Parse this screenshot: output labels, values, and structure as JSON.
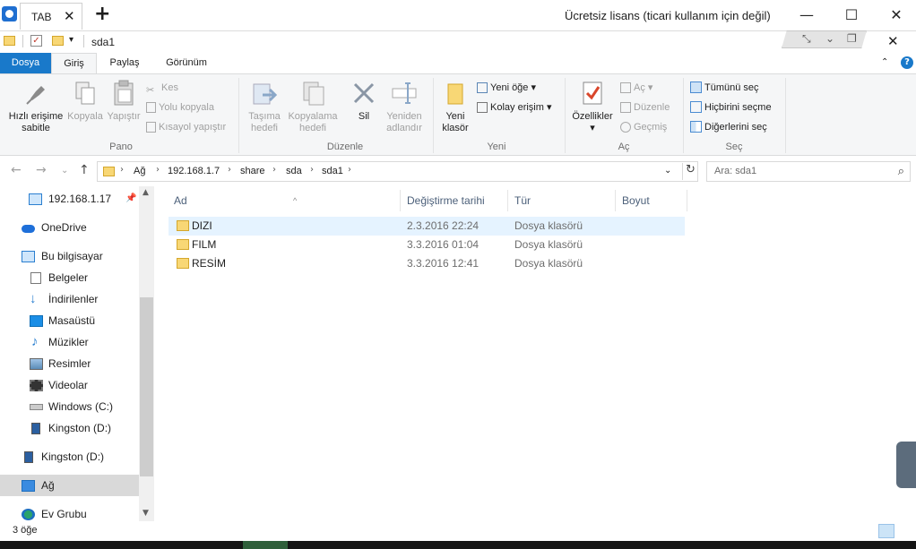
{
  "window": {
    "tab_label": "TAB",
    "license_text": "Ücretsiz lisans (ticari kullanım için değil)",
    "title": "sda1"
  },
  "ribbon_tabs": [
    "Dosya",
    "Giriş",
    "Paylaş",
    "Görünüm"
  ],
  "ribbon": {
    "pano": {
      "label": "Pano",
      "pin": "Hızlı erişime sabitle",
      "copy": "Kopyala",
      "paste": "Yapıştır",
      "cut": "Kes",
      "copy_path": "Yolu kopyala",
      "paste_shortcut": "Kısayol yapıştır"
    },
    "duzenle": {
      "label": "Düzenle",
      "move_to": [
        "Taşıma",
        "hedefi"
      ],
      "copy_to": [
        "Kopyalama",
        "hedefi"
      ],
      "delete": "Sil",
      "rename": [
        "Yeniden",
        "adlandır"
      ]
    },
    "yeni": {
      "label": "Yeni",
      "new_folder": [
        "Yeni",
        "klasör"
      ],
      "new_item": "Yeni öğe",
      "easy_access": "Kolay erişim"
    },
    "ac": {
      "label": "Aç",
      "properties": "Özellikler",
      "open": "Aç",
      "edit": "Düzenle",
      "history": "Geçmiş"
    },
    "sec": {
      "label": "Seç",
      "select_all": "Tümünü seç",
      "select_none": "Hiçbirini seçme",
      "invert": "Diğerlerini seç"
    }
  },
  "address": {
    "crumbs": [
      "Ağ",
      "192.168.1.7",
      "share",
      "sda",
      "sda1"
    ],
    "search_placeholder": "Ara: sda1"
  },
  "navpane": {
    "items": [
      {
        "label": "192.168.1.17",
        "icon": "monitor-icon"
      },
      {
        "label": "OneDrive",
        "icon": "cloud-icon"
      },
      {
        "label": "Bu bilgisayar",
        "icon": "computer-icon"
      },
      {
        "label": "Belgeler",
        "icon": "documents-icon"
      },
      {
        "label": "İndirilenler",
        "icon": "download-icon"
      },
      {
        "label": "Masaüstü",
        "icon": "desktop-icon"
      },
      {
        "label": "Müzikler",
        "icon": "music-icon"
      },
      {
        "label": "Resimler",
        "icon": "pictures-icon"
      },
      {
        "label": "Videolar",
        "icon": "videos-icon"
      },
      {
        "label": "Windows (C:)",
        "icon": "drive-icon"
      },
      {
        "label": "Kingston (D:)",
        "icon": "usb-drive-icon"
      },
      {
        "label": "Kingston (D:)",
        "icon": "usb-drive-icon"
      },
      {
        "label": "Ağ",
        "icon": "network-icon"
      },
      {
        "label": "Ev Grubu",
        "icon": "homegroup-icon"
      }
    ]
  },
  "filelist": {
    "columns": [
      "Ad",
      "Değiştirme tarihi",
      "Tür",
      "Boyut"
    ],
    "rows": [
      {
        "name": "DIZI",
        "date": "2.3.2016 22:24",
        "type": "Dosya klasörü",
        "size": ""
      },
      {
        "name": "FILM",
        "date": "3.3.2016 01:04",
        "type": "Dosya klasörü",
        "size": ""
      },
      {
        "name": "RESİM",
        "date": "3.3.2016 12:41",
        "type": "Dosya klasörü",
        "size": ""
      }
    ]
  },
  "status": {
    "item_count": "3 öğe"
  },
  "colors": {
    "accent": "#1979ca",
    "selection": "#e5f3ff",
    "folder": "#f8d775"
  }
}
